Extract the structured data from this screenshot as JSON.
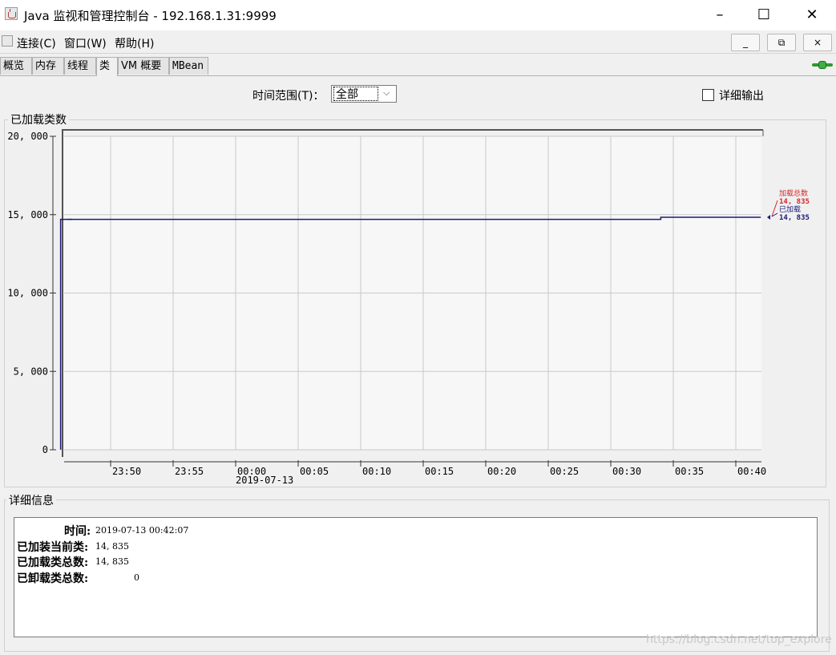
{
  "window": {
    "title": "Java 监视和管理控制台 - 192.168.1.31:9999",
    "minimize": "–",
    "maximize": "☐",
    "close": "✕"
  },
  "menu": {
    "connection": "连接(C)",
    "window": "窗口(W)",
    "help": "帮助(H)"
  },
  "mdi": {
    "minimize": "_",
    "restore": "⧉",
    "close": "×"
  },
  "tabs": [
    "概览",
    "内存",
    "线程",
    "类",
    "VM 概要",
    "MBean"
  ],
  "active_tab": "类",
  "toolbar": {
    "range_label": "时间范围(T)：",
    "range_value": "全部",
    "verbose_label": "详细输出",
    "verbose_checked": false
  },
  "chart": {
    "group_title": "已加载类数"
  },
  "chart_data": {
    "type": "line",
    "ylim": [
      0,
      20000
    ],
    "y_ticks": [
      "0",
      "5, 000",
      "10, 000",
      "15, 000",
      "20, 000"
    ],
    "x_ticks": [
      "23:50",
      "23:55",
      "00:00",
      "00:05",
      "00:10",
      "00:15",
      "00:20",
      "00:25",
      "00:30",
      "00:35",
      "00:40"
    ],
    "x_date_label": "2019-07-13",
    "grid": true,
    "series": [
      {
        "name": "加载总数",
        "color": "#d62728",
        "current_value": "14, 835"
      },
      {
        "name": "已加载",
        "color": "#1a1a7a",
        "current_value": "14, 835"
      }
    ],
    "points": [
      {
        "x": "23:46",
        "y": 0
      },
      {
        "x": "23:46",
        "y": 14700
      },
      {
        "x": "00:34",
        "y": 14700
      },
      {
        "x": "00:34",
        "y": 14835
      },
      {
        "x": "00:42",
        "y": 14835
      }
    ]
  },
  "details": {
    "group_title": "详细信息",
    "time_label": "时间:",
    "time_value": "2019-07-13 00:42:07",
    "current_label": "已加装当前类:",
    "current_value": "14, 835",
    "total_label": "已加载类总数:",
    "total_value": "14, 835",
    "unloaded_label": "已卸载类总数:",
    "unloaded_value": "0"
  },
  "watermark": "https://blog.csdn.net/top_explore"
}
